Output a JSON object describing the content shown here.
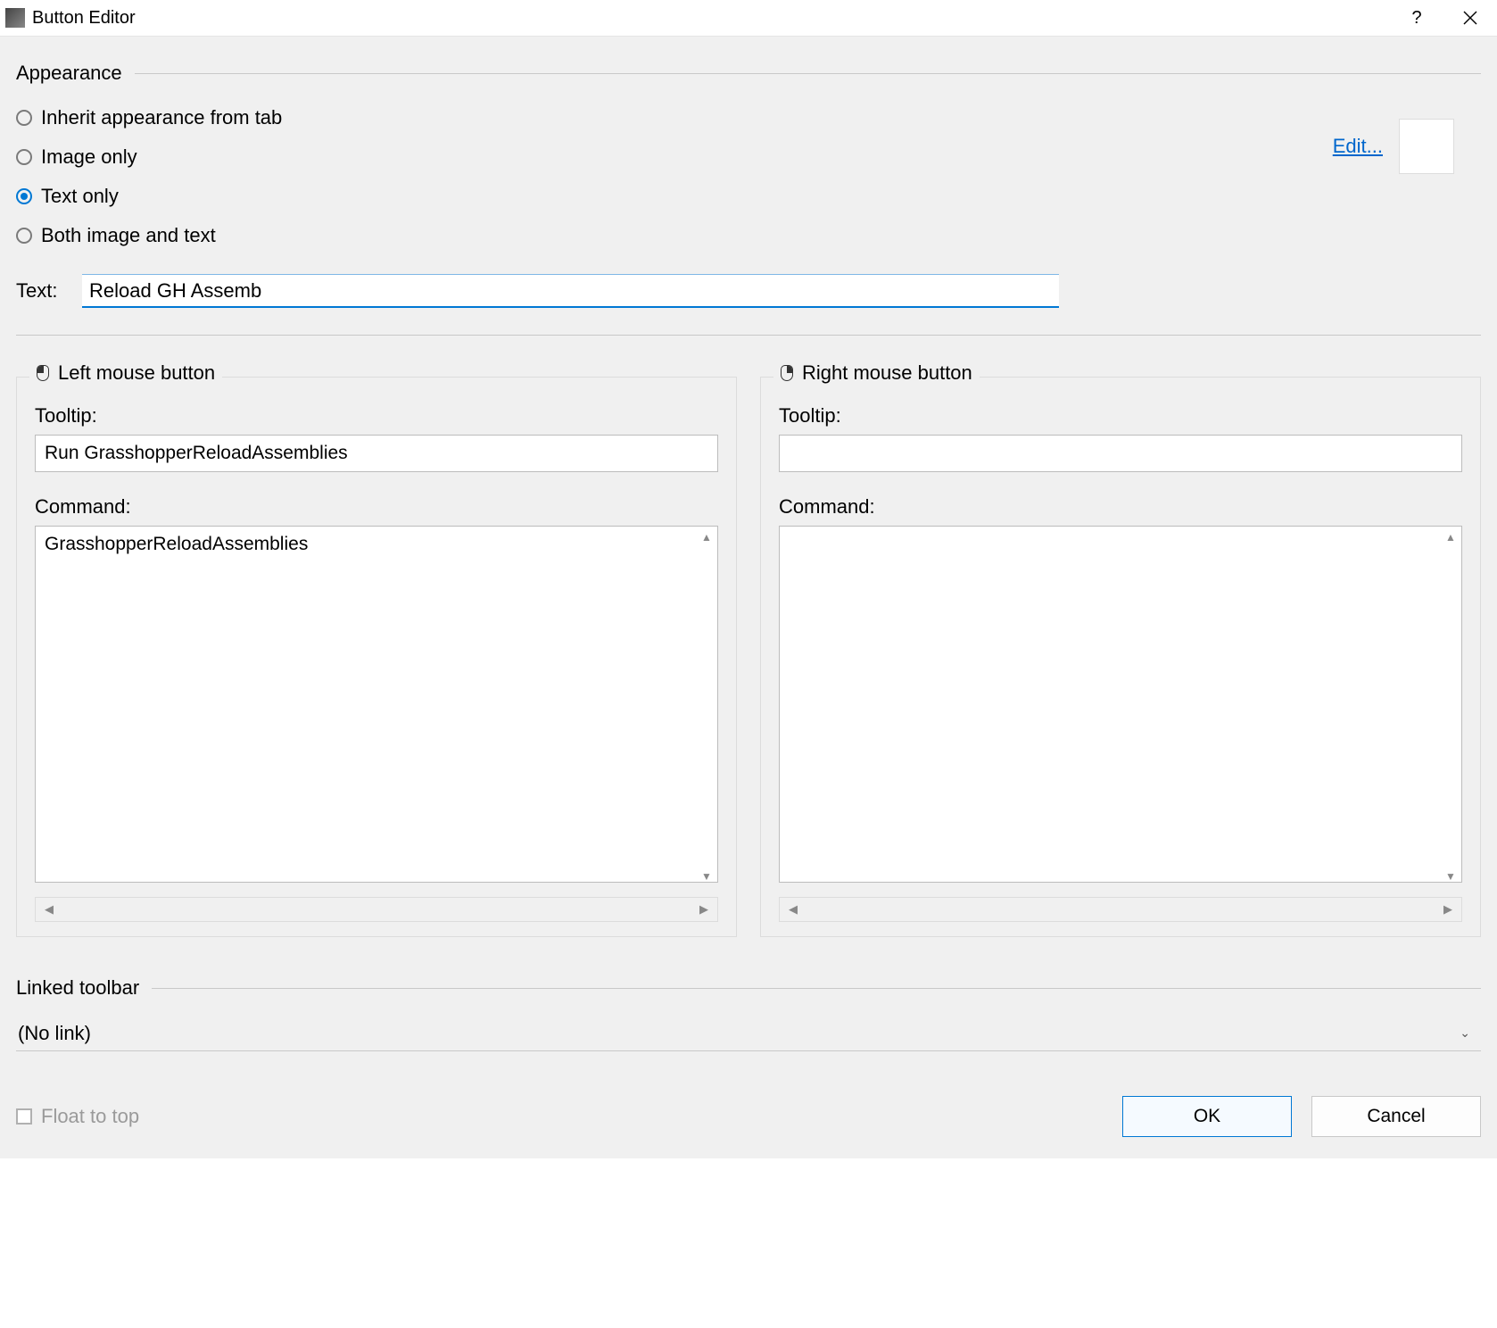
{
  "window": {
    "title": "Button Editor"
  },
  "appearance": {
    "group_label": "Appearance",
    "options": {
      "inherit": "Inherit appearance from tab",
      "image_only": "Image only",
      "text_only": "Text only",
      "both": "Both image and text"
    },
    "selected": "text_only",
    "edit_link": "Edit...",
    "text_label": "Text:",
    "text_value": "Reload GH Assemb"
  },
  "left_mouse": {
    "title": "Left mouse button",
    "tooltip_label": "Tooltip:",
    "tooltip_value": "Run GrasshopperReloadAssemblies",
    "command_label": "Command:",
    "command_value": "GrasshopperReloadAssemblies"
  },
  "right_mouse": {
    "title": "Right mouse button",
    "tooltip_label": "Tooltip:",
    "tooltip_value": "",
    "command_label": "Command:",
    "command_value": ""
  },
  "linked_toolbar": {
    "group_label": "Linked toolbar",
    "selected": "(No link)"
  },
  "footer": {
    "float_to_top": "Float to top",
    "ok": "OK",
    "cancel": "Cancel"
  }
}
